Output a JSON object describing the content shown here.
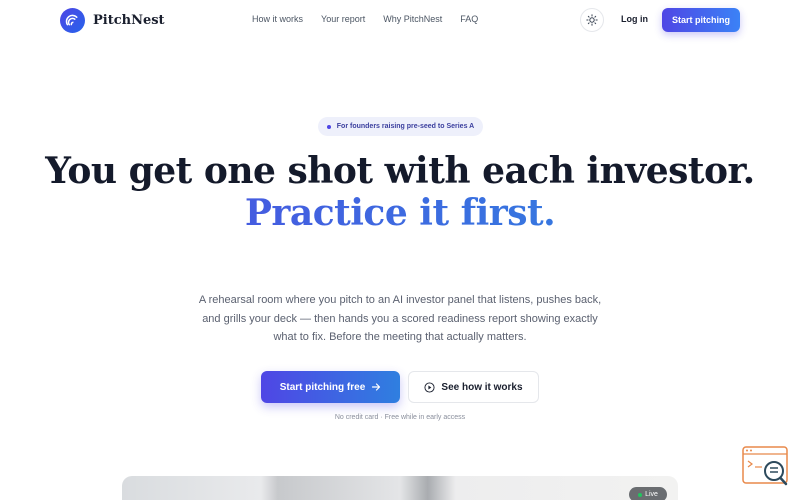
{
  "brand": {
    "name": "PitchNest",
    "accent": "#4f46e5"
  },
  "nav": {
    "links": [
      "How it works",
      "Your report",
      "Why PitchNest",
      "FAQ"
    ],
    "login": "Log in",
    "cta": "Start pitching"
  },
  "hero": {
    "badge": "For founders raising pre-seed to Series A",
    "headline": "You get one shot with each investor.",
    "headline_accent": "Practice it first.",
    "subtext": "A rehearsal room where you pitch to an AI investor panel that listens, pushes back, and grills your deck — then hands you a scored readiness report showing exactly what to fix. Before the meeting that actually matters.",
    "primary_cta": "Start pitching free",
    "secondary_cta": "See how it works",
    "fine_print": "No credit card · Free while in early access"
  },
  "preview": {
    "live_label": "Live"
  },
  "icons": {
    "theme": "sun-icon",
    "arrow": "arrow-right-icon",
    "play": "play-circle-icon",
    "widget": "search-chat-icon"
  }
}
